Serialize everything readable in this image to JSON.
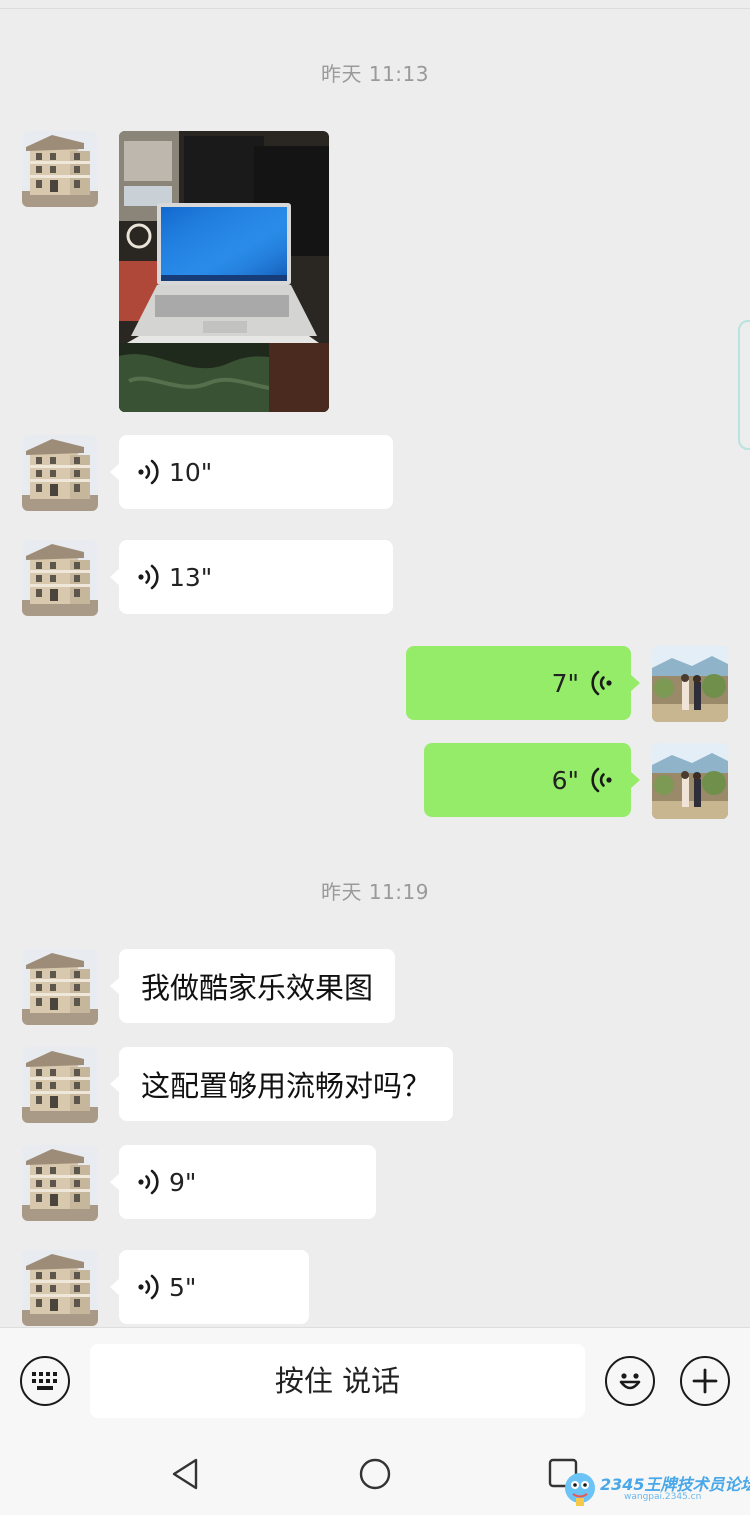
{
  "timestamps": [
    "昨天 11:13",
    "昨天 11:19"
  ],
  "messages": {
    "voice_1": {
      "duration": "10\""
    },
    "voice_2": {
      "duration": "13\""
    },
    "voice_3": {
      "duration": "7\""
    },
    "voice_4": {
      "duration": "6\""
    },
    "text_1": {
      "text": "我做酷家乐效果图"
    },
    "text_2": {
      "text": "这配置够用流畅对吗？"
    },
    "voice_5": {
      "duration": "9\""
    },
    "voice_6": {
      "duration": "5\""
    }
  },
  "input": {
    "hold_to_talk": "按住 说话"
  },
  "watermark": {
    "text": "2345王牌技术员论坛",
    "sub": "wangpai.2345.cn"
  },
  "colors": {
    "incoming_bubble": "#ffffff",
    "outgoing_bubble": "#95ec69",
    "background": "#ededed"
  },
  "icons": [
    "keyboard-icon",
    "emoji-icon",
    "plus-icon",
    "voice-wave-icon",
    "back-icon",
    "home-icon",
    "recent-apps-icon"
  ]
}
